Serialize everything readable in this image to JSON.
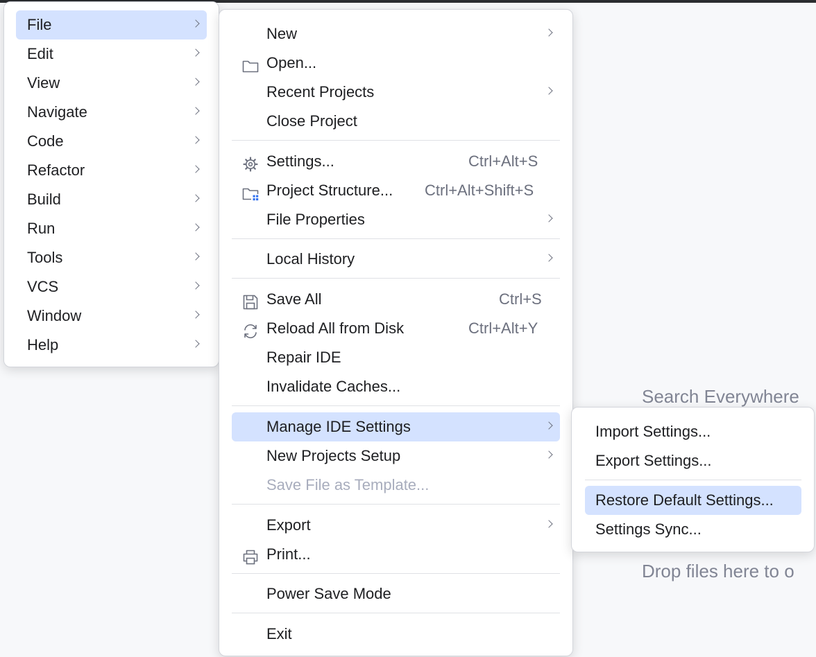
{
  "background": {
    "hint_search": "Search Everywhere",
    "hint_drop": "Drop files here to o"
  },
  "main_menu": {
    "items": [
      {
        "label": "File"
      },
      {
        "label": "Edit"
      },
      {
        "label": "View"
      },
      {
        "label": "Navigate"
      },
      {
        "label": "Code"
      },
      {
        "label": "Refactor"
      },
      {
        "label": "Build"
      },
      {
        "label": "Run"
      },
      {
        "label": "Tools"
      },
      {
        "label": "VCS"
      },
      {
        "label": "Window"
      },
      {
        "label": "Help"
      }
    ],
    "selected": "File"
  },
  "file_menu": {
    "new": {
      "label": "New"
    },
    "open": {
      "label": "Open..."
    },
    "recent_projects": {
      "label": "Recent Projects"
    },
    "close_project": {
      "label": "Close Project"
    },
    "settings": {
      "label": "Settings...",
      "shortcut": "Ctrl+Alt+S"
    },
    "project_structure": {
      "label": "Project Structure...",
      "shortcut": "Ctrl+Alt+Shift+S"
    },
    "file_properties": {
      "label": "File Properties"
    },
    "local_history": {
      "label": "Local History"
    },
    "save_all": {
      "label": "Save All",
      "shortcut": "Ctrl+S"
    },
    "reload_all": {
      "label": "Reload All from Disk",
      "shortcut": "Ctrl+Alt+Y"
    },
    "repair_ide": {
      "label": "Repair IDE"
    },
    "invalidate_caches": {
      "label": "Invalidate Caches..."
    },
    "manage_ide_settings": {
      "label": "Manage IDE Settings"
    },
    "new_projects_setup": {
      "label": "New Projects Setup"
    },
    "save_file_as_template": {
      "label": "Save File as Template...",
      "disabled": true
    },
    "export": {
      "label": "Export"
    },
    "print": {
      "label": "Print..."
    },
    "power_save_mode": {
      "label": "Power Save Mode"
    },
    "exit": {
      "label": "Exit"
    },
    "selected": "Manage IDE Settings"
  },
  "settings_submenu": {
    "import": {
      "label": "Import Settings..."
    },
    "export": {
      "label": "Export Settings..."
    },
    "restore_defaults": {
      "label": "Restore Default Settings..."
    },
    "settings_sync": {
      "label": "Settings Sync..."
    },
    "selected": "Restore Default Settings..."
  },
  "colors": {
    "selection": "#d4e2ff",
    "text": "#1e1f22",
    "shortcut": "#6c707e",
    "disabled": "#a8adbd",
    "hint": "#818594",
    "accent_icon": "#3574f0"
  },
  "icons": {
    "open": "folder-icon",
    "settings": "gear-icon",
    "project_structure": "project-structure-icon",
    "save_all": "floppy-disk-icon",
    "reload_all": "reload-icon",
    "print": "printer-icon",
    "submenu": "chevron-right-icon"
  }
}
